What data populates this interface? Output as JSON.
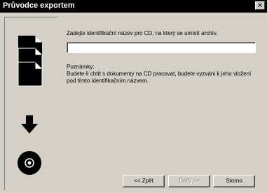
{
  "window": {
    "title": "Průvodce exportem",
    "close_label": "✕"
  },
  "form": {
    "prompt": "Zadejte identifikační název pro CD, na který se umístí archív.",
    "input_value": "",
    "notes_heading": "Poznámky:",
    "notes_text": "Budete-li chtít s dokumenty na CD pracovat, budete vyzváni k jeho vložení pod tímto identifikačním názvem."
  },
  "buttons": {
    "back": "<< Zpět",
    "next": "Další >>",
    "cancel": "Storno"
  },
  "icons": {
    "documents": "documents-stack-icon",
    "arrow": "arrow-down-icon",
    "disc": "cd-disc-icon"
  }
}
